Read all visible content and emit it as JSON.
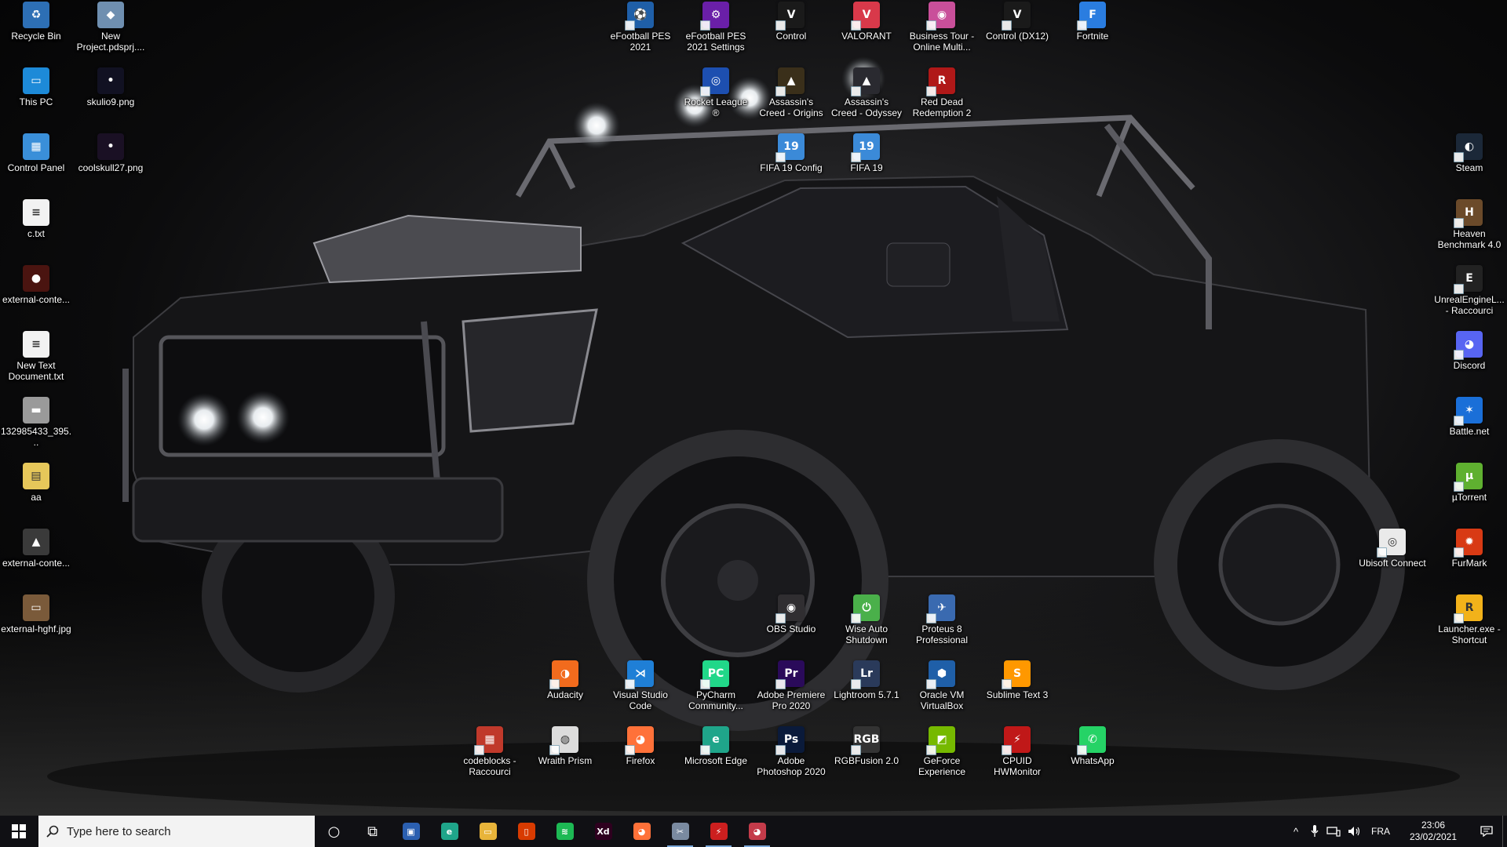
{
  "desktop": {
    "icons": [
      {
        "label": "Recycle Bin",
        "icon": "recycle-bin-icon",
        "bg": "#2d6fb5",
        "glyph": "♻",
        "arrow": false
      },
      {
        "label": "New Project.pdsprj....",
        "icon": "proteus-project-icon",
        "bg": "#6f8fb0",
        "glyph": "◆",
        "arrow": false
      },
      {
        "label": "This PC",
        "icon": "computer-icon",
        "bg": "#1d8ad8",
        "glyph": "▭",
        "arrow": false
      },
      {
        "label": "skulio9.png",
        "icon": "image-file-icon",
        "bg": "#111122",
        "glyph": "•",
        "arrow": false
      },
      {
        "label": "Control Panel",
        "icon": "control-panel-icon",
        "bg": "#3a8fd9",
        "glyph": "▦",
        "arrow": false
      },
      {
        "label": "coolskull27.png",
        "icon": "image-file-icon",
        "bg": "#1a1024",
        "glyph": "•",
        "arrow": false
      },
      {
        "label": "c.txt",
        "icon": "text-file-icon",
        "bg": "#f2f2f2",
        "glyph": "≡",
        "arrow": false
      },
      {
        "label": "external-conte...",
        "icon": "image-file-icon",
        "bg": "#4a1410",
        "glyph": "●",
        "arrow": false
      },
      {
        "label": "New Text Document.txt",
        "icon": "text-file-icon",
        "bg": "#f2f2f2",
        "glyph": "≡",
        "arrow": false
      },
      {
        "label": "132985433_395...",
        "icon": "image-file-icon",
        "bg": "#9a9a9a",
        "glyph": "▬",
        "arrow": false
      },
      {
        "label": "aa",
        "icon": "zip-folder-icon",
        "bg": "#e6c75a",
        "glyph": "▤",
        "arrow": false
      },
      {
        "label": "external-conte...",
        "icon": "image-file-icon",
        "bg": "#3a3a3a",
        "glyph": "▲",
        "arrow": false
      },
      {
        "label": "external-hghf.jpg",
        "icon": "image-file-icon",
        "bg": "#7a5a3a",
        "glyph": "▭",
        "arrow": false
      },
      {
        "label": "eFootball PES 2021",
        "icon": "pes-icon",
        "bg": "#1f5fa8",
        "glyph": "⚽",
        "arrow": true
      },
      {
        "label": "eFootball PES 2021 Settings",
        "icon": "pes-settings-icon",
        "bg": "#6a1fa8",
        "glyph": "⚙",
        "arrow": true
      },
      {
        "label": "Control",
        "icon": "control-game-icon",
        "bg": "#1a1a1a",
        "glyph": "V",
        "arrow": true
      },
      {
        "label": "VALORANT",
        "icon": "valorant-icon",
        "bg": "#d8394a",
        "glyph": "V",
        "arrow": true
      },
      {
        "label": "Business Tour - Online Multi...",
        "icon": "business-tour-icon",
        "bg": "#c94f9a",
        "glyph": "◉",
        "arrow": true
      },
      {
        "label": "Control (DX12)",
        "icon": "control-game-icon",
        "bg": "#1a1a1a",
        "glyph": "V",
        "arrow": true
      },
      {
        "label": "Fortnite",
        "icon": "fortnite-icon",
        "bg": "#2a7de0",
        "glyph": "F",
        "arrow": true
      },
      {
        "label": "Rocket League ®",
        "icon": "rocket-league-icon",
        "bg": "#1d4fb0",
        "glyph": "◎",
        "arrow": true
      },
      {
        "label": "Assassin's Creed - Origins",
        "icon": "assassins-creed-icon",
        "bg": "#3a2f1a",
        "glyph": "▲",
        "arrow": true
      },
      {
        "label": "Assassin's Creed - Odyssey",
        "icon": "assassins-creed-icon",
        "bg": "#2a2a30",
        "glyph": "▲",
        "arrow": true
      },
      {
        "label": "Red Dead Redemption 2",
        "icon": "rdr2-icon",
        "bg": "#b01818",
        "glyph": "R",
        "arrow": true
      },
      {
        "label": "FIFA 19 Config",
        "icon": "fifa-icon",
        "bg": "#3b8ad8",
        "glyph": "19",
        "arrow": true
      },
      {
        "label": "FIFA 19",
        "icon": "fifa-icon",
        "bg": "#3b8ad8",
        "glyph": "19",
        "arrow": true
      },
      {
        "label": "Steam",
        "icon": "steam-icon",
        "bg": "#1b2838",
        "glyph": "◐",
        "arrow": true
      },
      {
        "label": "Heaven Benchmark 4.0",
        "icon": "heaven-benchmark-icon",
        "bg": "#6b4a2a",
        "glyph": "H",
        "arrow": true
      },
      {
        "label": "UnrealEngineL... - Raccourci",
        "icon": "epic-games-icon",
        "bg": "#222222",
        "glyph": "E",
        "arrow": true
      },
      {
        "label": "Discord",
        "icon": "discord-icon",
        "bg": "#5865f2",
        "glyph": "◕",
        "arrow": true
      },
      {
        "label": "Battle.net",
        "icon": "battlenet-icon",
        "bg": "#1a6fd8",
        "glyph": "✶",
        "arrow": true
      },
      {
        "label": "µTorrent",
        "icon": "utorrent-icon",
        "bg": "#5fb030",
        "glyph": "µ",
        "arrow": true
      },
      {
        "label": "Ubisoft Connect",
        "icon": "ubisoft-icon",
        "bg": "#eaeaea",
        "glyph": "◎",
        "arrow": true
      },
      {
        "label": "FurMark",
        "icon": "furmark-icon",
        "bg": "#d83a14",
        "glyph": "✹",
        "arrow": true
      },
      {
        "label": "Launcher.exe - Shortcut",
        "icon": "rockstar-launcher-icon",
        "bg": "#f2b21a",
        "glyph": "R",
        "arrow": true
      },
      {
        "label": "OBS Studio",
        "icon": "obs-icon",
        "bg": "#302e31",
        "glyph": "◉",
        "arrow": true
      },
      {
        "label": "Wise Auto Shutdown",
        "icon": "wise-shutdown-icon",
        "bg": "#4ab04a",
        "glyph": "⏻",
        "arrow": true
      },
      {
        "label": "Proteus 8 Professional",
        "icon": "proteus-icon",
        "bg": "#3a6ab0",
        "glyph": "✈",
        "arrow": true
      },
      {
        "label": "Audacity",
        "icon": "audacity-icon",
        "bg": "#f26b1d",
        "glyph": "◑",
        "arrow": true
      },
      {
        "label": "Visual Studio Code",
        "icon": "vscode-icon",
        "bg": "#1f7fd6",
        "glyph": "⋊",
        "arrow": true
      },
      {
        "label": "PyCharm Community...",
        "icon": "pycharm-icon",
        "bg": "#21d789",
        "glyph": "PC",
        "arrow": true
      },
      {
        "label": "Adobe Premiere Pro 2020",
        "icon": "premiere-icon",
        "bg": "#2a0a5a",
        "glyph": "Pr",
        "arrow": true
      },
      {
        "label": "Lightroom 5.7.1",
        "icon": "lightroom-icon",
        "bg": "#2a3a5a",
        "glyph": "Lr",
        "arrow": true
      },
      {
        "label": "Oracle VM VirtualBox",
        "icon": "virtualbox-icon",
        "bg": "#1f5fa8",
        "glyph": "⬢",
        "arrow": true
      },
      {
        "label": "Sublime Text 3",
        "icon": "sublime-icon",
        "bg": "#ff9800",
        "glyph": "S",
        "arrow": true
      },
      {
        "label": "codeblocks - Raccourci",
        "icon": "codeblocks-icon",
        "bg": "#c0392b",
        "glyph": "▦",
        "arrow": true
      },
      {
        "label": "Wraith Prism",
        "icon": "cooler-master-icon",
        "bg": "#dcdcdc",
        "glyph": "◍",
        "arrow": true
      },
      {
        "label": "Firefox",
        "icon": "firefox-icon",
        "bg": "#ff7139",
        "glyph": "◕",
        "arrow": true
      },
      {
        "label": "Microsoft Edge",
        "icon": "edge-icon",
        "bg": "#1fa58a",
        "glyph": "e",
        "arrow": true
      },
      {
        "label": "Adobe Photoshop 2020",
        "icon": "photoshop-icon",
        "bg": "#0a1a3a",
        "glyph": "Ps",
        "arrow": true
      },
      {
        "label": "RGBFusion 2.0",
        "icon": "rgb-fusion-icon",
        "bg": "#333333",
        "glyph": "RGB",
        "arrow": true
      },
      {
        "label": "GeForce Experience",
        "icon": "geforce-icon",
        "bg": "#76b900",
        "glyph": "◩",
        "arrow": true
      },
      {
        "label": "CPUID HWMonitor",
        "icon": "hwmonitor-icon",
        "bg": "#c01818",
        "glyph": "⚡",
        "arrow": true
      },
      {
        "label": "WhatsApp",
        "icon": "whatsapp-icon",
        "bg": "#25d366",
        "glyph": "✆",
        "arrow": true
      }
    ]
  },
  "taskbar": {
    "start_icon": "windows-start-icon",
    "search_placeholder": "Type here to search",
    "apps": [
      {
        "name": "cortana-icon",
        "bg": "transparent",
        "glyph": "○",
        "open": false
      },
      {
        "name": "task-view-icon",
        "bg": "transparent",
        "glyph": "⧉",
        "open": false
      },
      {
        "name": "microsoft-store-icon",
        "bg": "#2b5fb0",
        "glyph": "▣",
        "open": false
      },
      {
        "name": "edge-icon",
        "bg": "#1fa58a",
        "glyph": "e",
        "open": false
      },
      {
        "name": "file-explorer-icon",
        "bg": "#e8b43a",
        "glyph": "▭",
        "open": false
      },
      {
        "name": "office-icon",
        "bg": "#d83b01",
        "glyph": "▯",
        "open": false
      },
      {
        "name": "spotify-icon",
        "bg": "#1db954",
        "glyph": "≋",
        "open": false
      },
      {
        "name": "adobe-xd-icon",
        "bg": "#2e001f",
        "glyph": "Xd",
        "open": false
      },
      {
        "name": "firefox-icon",
        "bg": "#ff7139",
        "glyph": "◕",
        "open": false
      },
      {
        "name": "snipping-tool-icon",
        "bg": "#7a8aa0",
        "glyph": "✂",
        "open": true
      },
      {
        "name": "flash-icon",
        "bg": "#cc1f1f",
        "glyph": "⚡",
        "open": true
      },
      {
        "name": "discord-alt-icon",
        "bg": "#c43b4a",
        "glyph": "◕",
        "open": true
      }
    ],
    "tray": {
      "chevron": "^",
      "language": "FRA",
      "time": "23:06",
      "date": "23/02/2021"
    }
  },
  "colors": {
    "taskbar": "#101014",
    "search_bg": "#f3f3f3",
    "accent": "#7aa7d8"
  }
}
